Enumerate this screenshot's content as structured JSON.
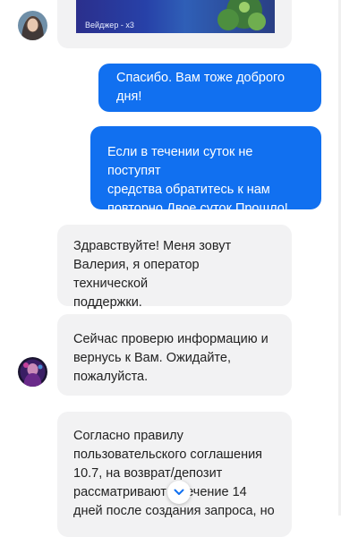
{
  "messages": [
    {
      "from": "operator",
      "text": "Вейджер - x3"
    },
    {
      "from": "user",
      "text": "Спасибо. Вам тоже доброго дня!"
    },
    {
      "from": "user",
      "lines": [
        "Если в течении суток не поступят",
        "средства обратитесь к нам",
        "повторно.Двое суток Прошло!"
      ]
    },
    {
      "from": "operator",
      "lines": [
        "Здравствуйте! Меня зовут",
        "Валерия, я оператор технической",
        "поддержки."
      ]
    },
    {
      "from": "operator",
      "lines": [
        "Сейчас проверю информацию и",
        "вернусь к Вам. Ожидайте,",
        "пожалуйста."
      ]
    },
    {
      "from": "operator",
      "lines": [
        "Согласно правилу",
        "пользовательского соглашения",
        "10.7, на возврат/депозит",
        "рассматривают в течение 14",
        "дней после создания запроса, но"
      ]
    }
  ],
  "colors": {
    "user_bubble": "#1170f0",
    "operator_bubble": "#f2f2f3"
  },
  "icons": {
    "scroll_down": "chevron-down-icon"
  }
}
